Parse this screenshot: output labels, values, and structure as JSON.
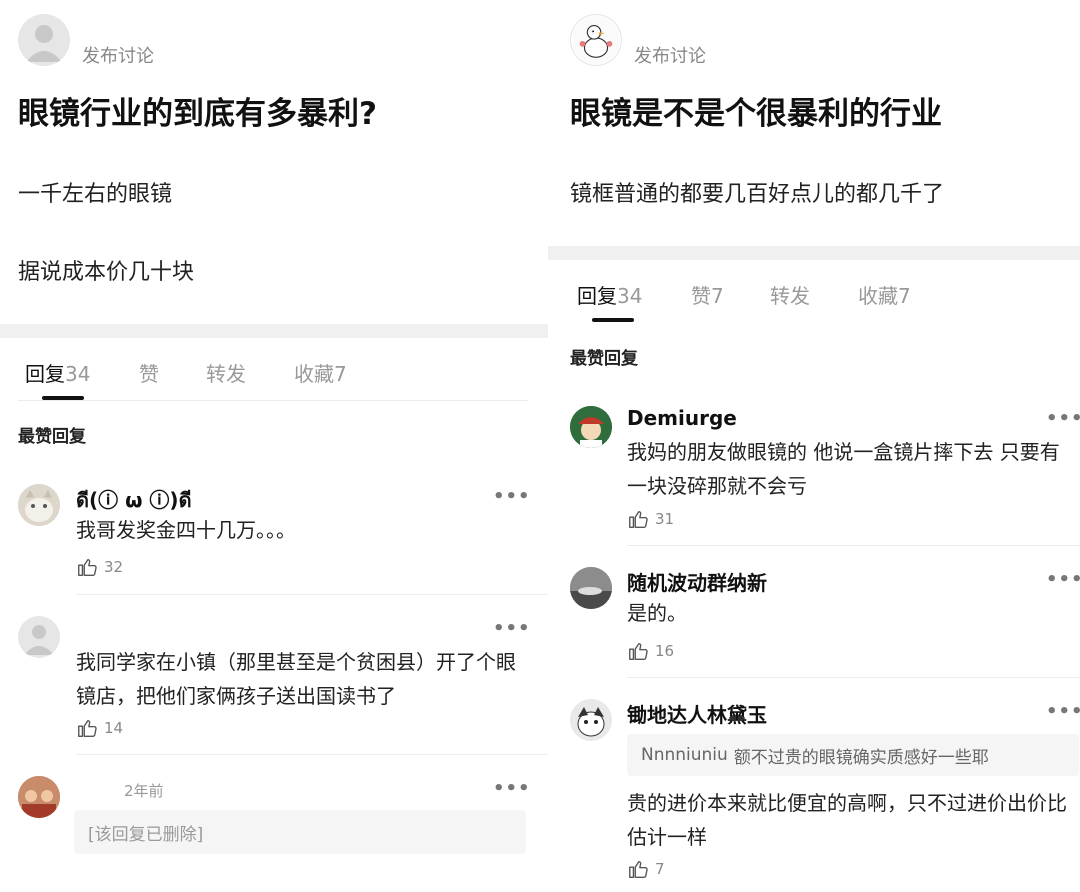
{
  "left": {
    "post_meta": "发布讨论",
    "title": "眼镜行业的到底有多暴利?",
    "body_lines": [
      "一千左右的眼镜",
      "据说成本价几十块"
    ],
    "tabs": [
      {
        "label": "回复",
        "count": "34"
      },
      {
        "label": "赞",
        "count": ""
      },
      {
        "label": "转发",
        "count": ""
      },
      {
        "label": "收藏",
        "count": "7"
      }
    ],
    "section_label": "最赞回复",
    "comments": [
      {
        "name": "ดี(ⓘ ω ⓘ)ดี",
        "text": "我哥发奖金四十几万。。。",
        "likes": "32"
      },
      {
        "name": "",
        "text": "我同学家在小镇（那里甚至是个贫困县）开了个眼镜店，把他们家俩孩子送出国读书了",
        "likes": "14"
      },
      {
        "time": "2年前",
        "deleted_text": "[该回复已删除]"
      }
    ]
  },
  "right": {
    "post_meta": "发布讨论",
    "title": "眼镜是不是个很暴利的行业",
    "body_lines": [
      "镜框普通的都要几百好点儿的都几千了"
    ],
    "tabs": [
      {
        "label": "回复",
        "count": "34"
      },
      {
        "label": "赞",
        "count": "7"
      },
      {
        "label": "转发",
        "count": ""
      },
      {
        "label": "收藏",
        "count": "7"
      }
    ],
    "section_label": "最赞回复",
    "comments": [
      {
        "name": "Demiurge",
        "text": "我妈的朋友做眼镜的 他说一盒镜片摔下去 只要有一块没碎那就不会亏",
        "likes": "31"
      },
      {
        "name": "随机波动群纳新",
        "text": "是的。",
        "likes": "16"
      },
      {
        "name": "锄地达人林黛玉",
        "quote_name": "Nnnniuniu",
        "quote_text": "额不过贵的眼镜确实质感好一些耶",
        "text": "贵的进价本来就比便宜的高啊，只不过进价出价比估计一样",
        "likes": "7"
      }
    ]
  },
  "icons": {
    "more": "more-dots-icon",
    "like": "thumb-up-icon"
  },
  "more_glyph": "•••"
}
